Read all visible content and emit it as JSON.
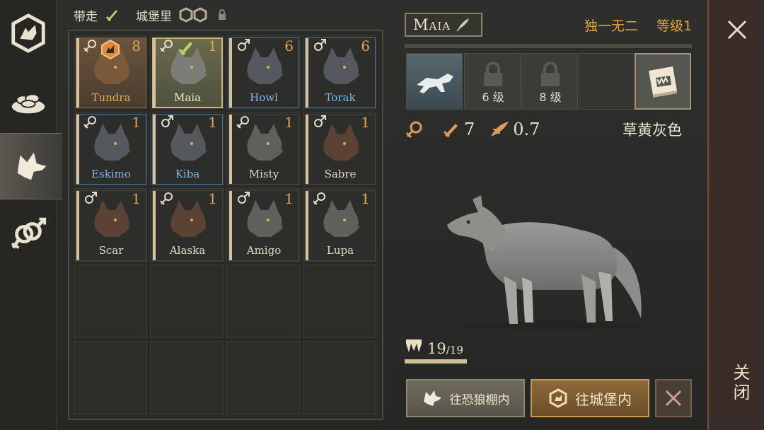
{
  "nav": {
    "items": [
      {
        "icon": "pack-emblem-icon"
      },
      {
        "icon": "food-bowl-icon"
      },
      {
        "icon": "wolf-head-icon",
        "active": true
      },
      {
        "icon": "gender-breeding-icon"
      }
    ]
  },
  "top": {
    "carry_label": "带走",
    "castle_label": "城堡里"
  },
  "wolves": [
    {
      "name": "Tundra",
      "count": "8",
      "sex": "female",
      "style": "tundra",
      "name_color": "orange"
    },
    {
      "name": "Maia",
      "count": "1",
      "sex": "female",
      "style": "selected",
      "name_color": "light"
    },
    {
      "name": "Howl",
      "count": "6",
      "sex": "male",
      "style": "blueframe",
      "name_color": "blue"
    },
    {
      "name": "Torak",
      "count": "6",
      "sex": "male",
      "style": "blueframe",
      "name_color": "blue"
    },
    {
      "name": "Eskimo",
      "count": "1",
      "sex": "female",
      "style": "blueframe",
      "name_color": "blue"
    },
    {
      "name": "Kiba",
      "count": "1",
      "sex": "male",
      "style": "blueframe",
      "name_color": "blue"
    },
    {
      "name": "Misty",
      "count": "1",
      "sex": "female",
      "style": "",
      "name_color": ""
    },
    {
      "name": "Sabre",
      "count": "1",
      "sex": "male",
      "style": "",
      "name_color": ""
    },
    {
      "name": "Scar",
      "count": "1",
      "sex": "male",
      "style": "",
      "name_color": ""
    },
    {
      "name": "Alaska",
      "count": "1",
      "sex": "female",
      "style": "",
      "name_color": ""
    },
    {
      "name": "Amigo",
      "count": "1",
      "sex": "male",
      "style": "",
      "name_color": ""
    },
    {
      "name": "Lupa",
      "count": "1",
      "sex": "female",
      "style": "",
      "name_color": ""
    }
  ],
  "detail": {
    "name": "Maia",
    "rarity": "独一无二",
    "level": "等级1",
    "slots": [
      {
        "type": "ability",
        "icon": "wolf-leap-icon"
      },
      {
        "type": "locked",
        "label": "6 级"
      },
      {
        "type": "locked",
        "label": "8 级"
      },
      {
        "type": "empty"
      }
    ],
    "sex_icon": "female-icon",
    "attack": "7",
    "speed": "0.7",
    "color_name": "草黄灰色",
    "hunger_current": "19",
    "hunger_max": "/19",
    "hunger_fraction": 1.0
  },
  "buttons": {
    "to_kennel": "往恐狼棚内",
    "to_castle": "往城堡内"
  },
  "close_label": "关闭",
  "colors": {
    "accent_orange": "#e4a33e",
    "green": "#b6d46a",
    "blue_name": "#7fb6e3"
  }
}
